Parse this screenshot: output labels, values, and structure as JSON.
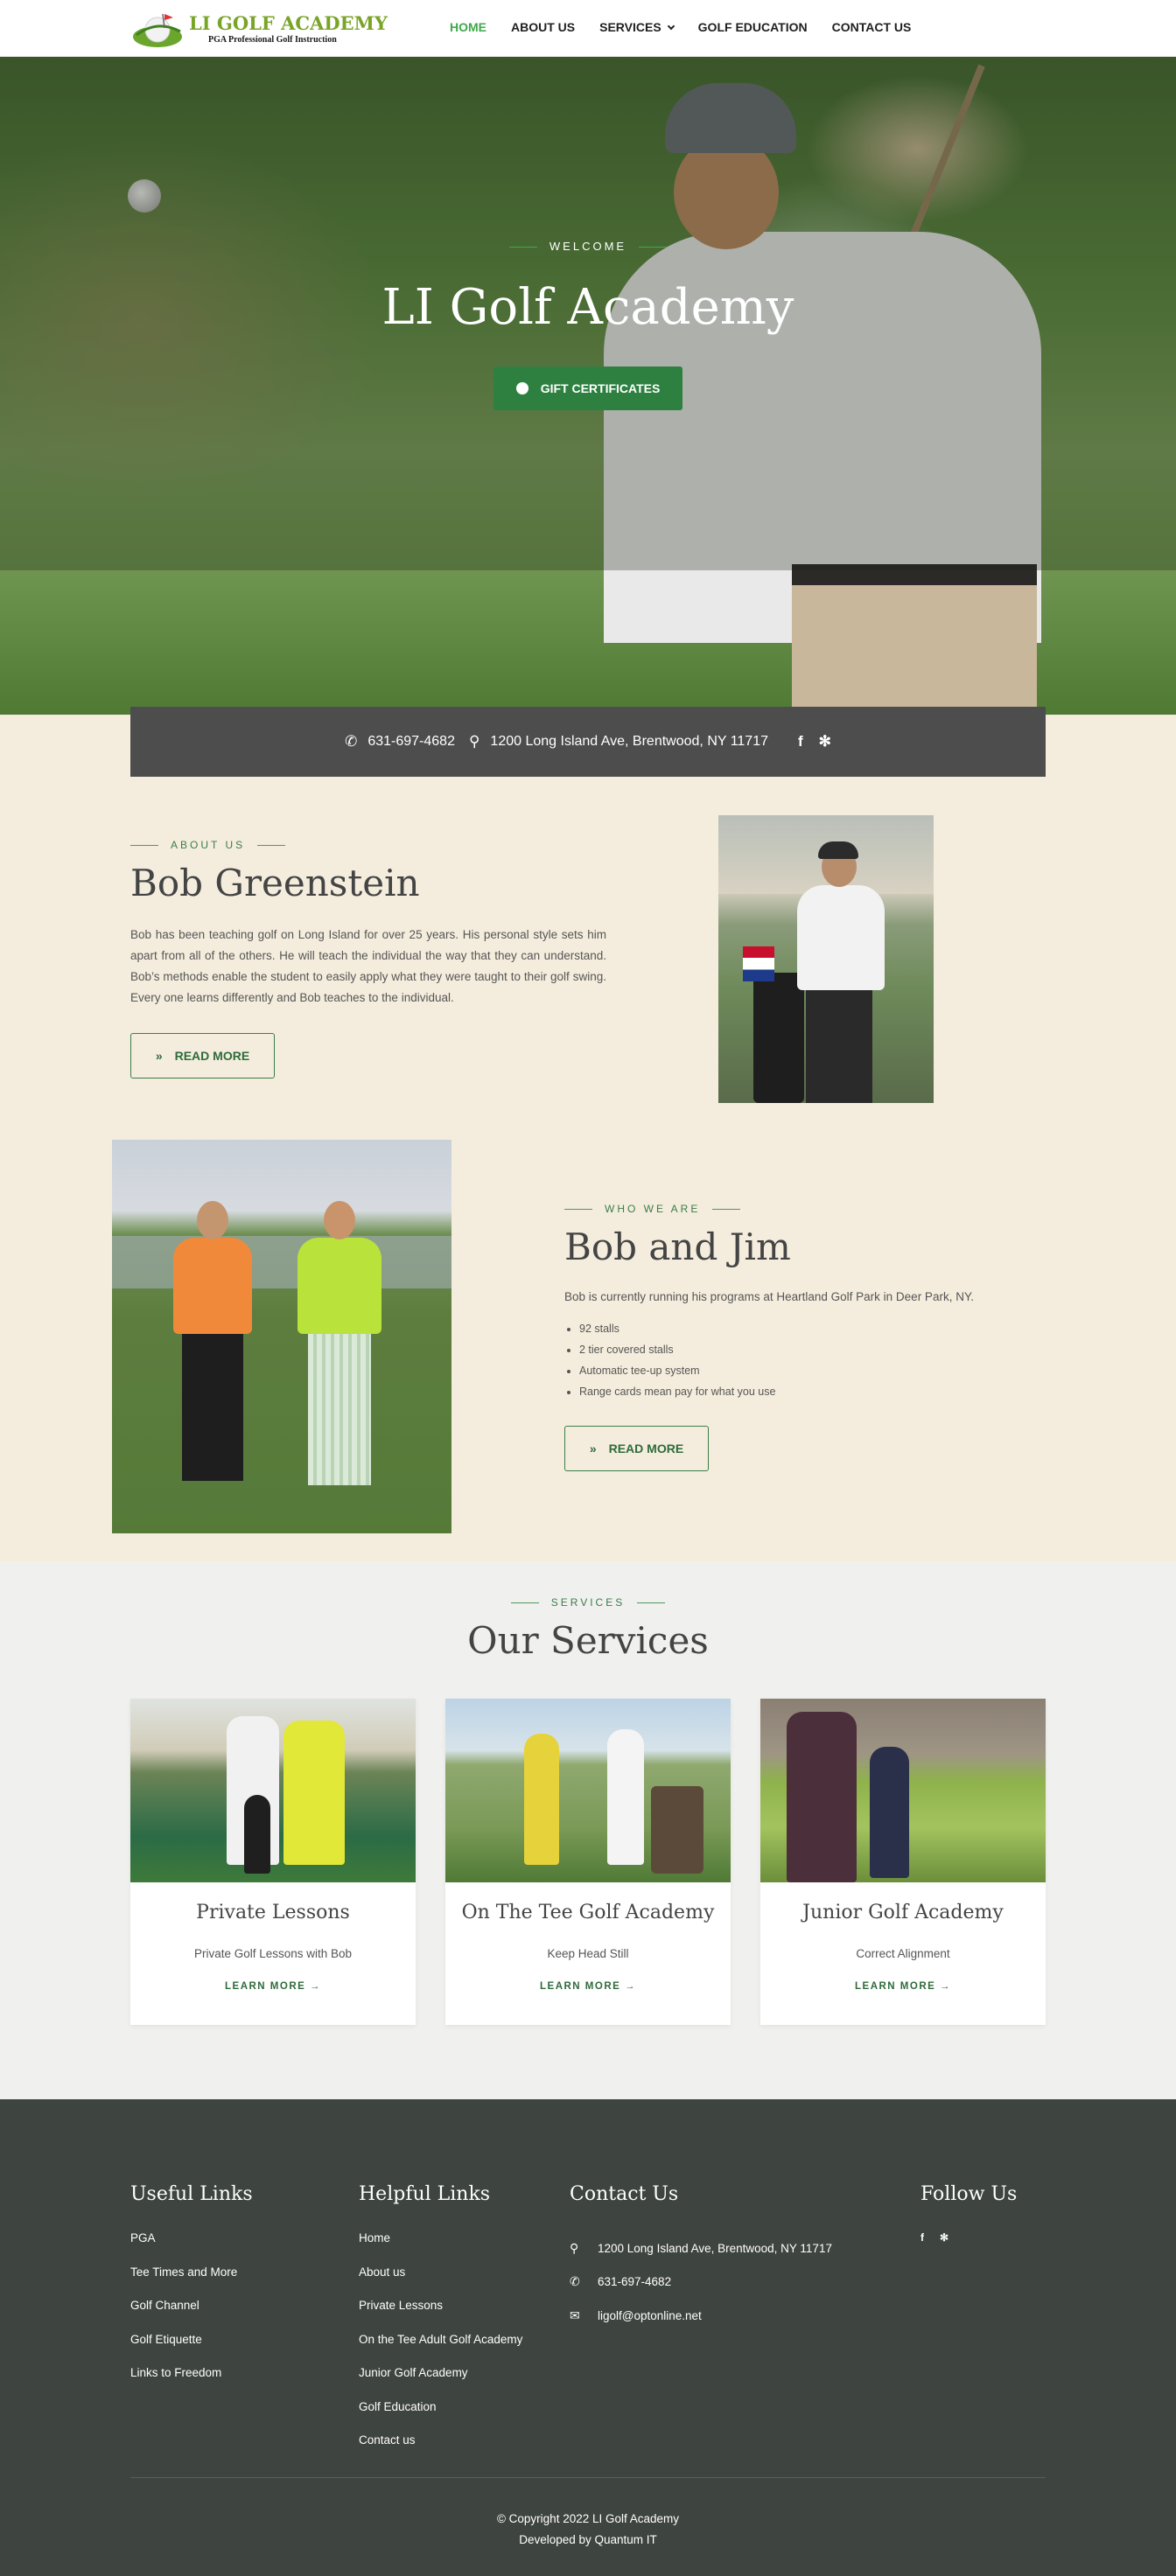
{
  "header": {
    "logo_title": "LI GOLF ACADEMY",
    "logo_subtitle": "PGA Professional Golf Instruction",
    "nav": [
      {
        "label": "HOME",
        "active": true
      },
      {
        "label": "ABOUT US"
      },
      {
        "label": "SERVICES",
        "has_dropdown": true
      },
      {
        "label": "GOLF EDUCATION"
      },
      {
        "label": "CONTACT US"
      }
    ]
  },
  "hero": {
    "eyebrow": "WELCOME",
    "title": "LI Golf Academy",
    "button_label": "GIFT CERTIFICATES"
  },
  "contact_bar": {
    "phone": "631-697-4682",
    "address": "1200 Long Island Ave, Brentwood, NY 11717",
    "social_icons": [
      "facebook-icon",
      "yelp-icon"
    ]
  },
  "about": {
    "eyebrow": "ABOUT US",
    "title": "Bob Greenstein",
    "text": "Bob has been teaching golf on Long Island for over 25 years. His personal style sets him apart from all of the others. He will teach the individual the way that they can understand. Bob’s methods enable the student to easily apply what they were taught to their golf swing. Every one learns differently and Bob teaches to the individual.",
    "button_label": "READ MORE"
  },
  "who": {
    "eyebrow": "WHO WE ARE",
    "title": "Bob and Jim",
    "text": "Bob is currently running his programs at Heartland Golf Park in Deer Park, NY.",
    "list": [
      "92 stalls",
      "2 tier covered stalls",
      "Automatic tee-up system",
      "Range cards mean pay for what you use"
    ],
    "button_label": "READ MORE"
  },
  "services": {
    "eyebrow": "SERVICES",
    "title": "Our Services",
    "cards": [
      {
        "title": "Private Lessons",
        "desc": "Private Golf Lessons with Bob",
        "link": "LEARN MORE →"
      },
      {
        "title": "On The Tee Golf Academy",
        "desc": "Keep Head Still",
        "link": "LEARN MORE →"
      },
      {
        "title": "Junior Golf Academy",
        "desc": "Correct Alignment",
        "link": "LEARN MORE →"
      }
    ]
  },
  "footer": {
    "useful_title": "Useful Links",
    "useful_links": [
      "PGA",
      "Tee Times and More",
      "Golf Channel",
      "Golf Etiquette",
      "Links to Freedom"
    ],
    "helpful_title": "Helpful Links",
    "helpful_links": [
      "Home",
      "About us",
      "Private Lessons",
      "On the Tee Adult Golf Academy",
      "Junior Golf Academy",
      "Golf Education",
      "Contact us"
    ],
    "contact_title": "Contact Us",
    "contact": {
      "address": "1200 Long Island Ave, Brentwood, NY 11717",
      "phone": "631-697-4682",
      "email": "ligolf@optonline.net"
    },
    "follow_title": "Follow Us",
    "copyright": "© Copyright 2022 LI Golf Academy",
    "developer": "Developed by Quantum IT"
  },
  "colors": {
    "accent_green": "#3fa84a",
    "button_green": "#2e8040",
    "about_bg": "#f4eddd",
    "services_bg": "#f0f0ee",
    "footer_bg": "#3e443f",
    "contact_bar_bg": "#4d4d4d"
  }
}
